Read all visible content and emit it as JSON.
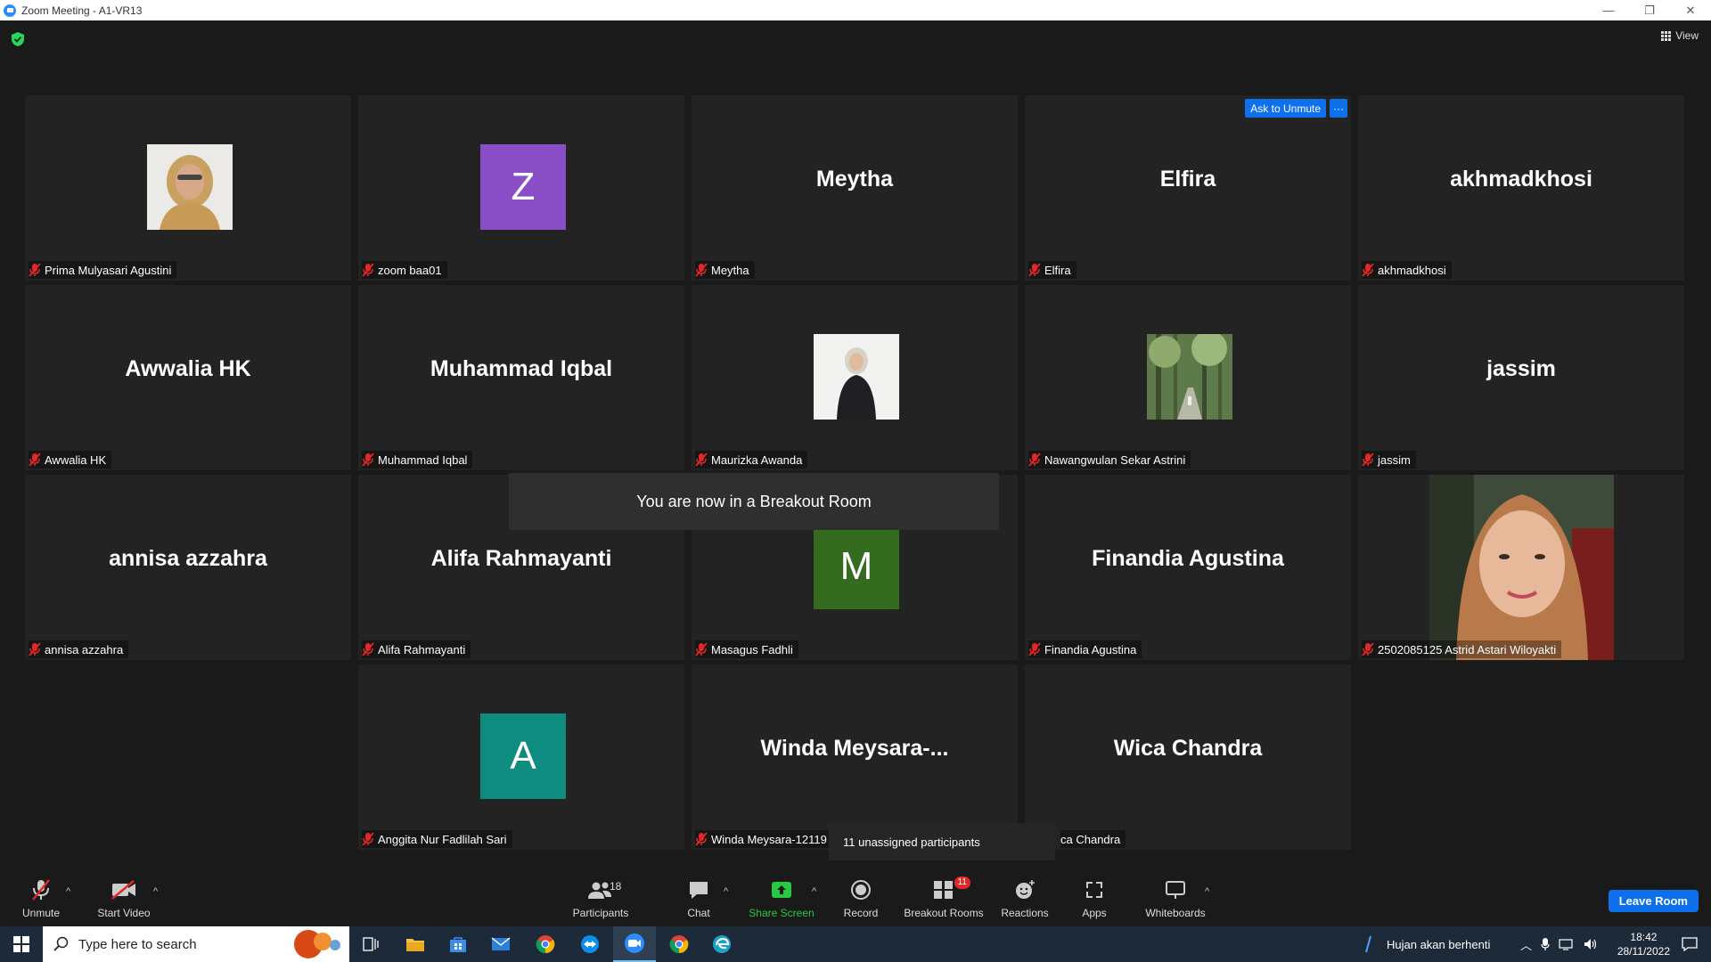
{
  "window": {
    "title": "Zoom Meeting - A1-VR13",
    "minimize": "—",
    "restore": "❐",
    "close": "✕"
  },
  "top": {
    "view_label": "View"
  },
  "tiles": [
    {
      "display": "",
      "label": "Prima Mulyasari Agustini",
      "kind": "photo"
    },
    {
      "display": "Z",
      "label": "zoom baa01",
      "kind": "letter",
      "color": "#8a4fc7"
    },
    {
      "display": "Meytha",
      "label": "Meytha",
      "kind": "name"
    },
    {
      "display": "Elfira",
      "label": "Elfira",
      "kind": "name",
      "ask_unmute": "Ask to Unmute",
      "more": "···"
    },
    {
      "display": "akhmadkhosi",
      "label": "akhmadkhosi",
      "kind": "name"
    },
    {
      "display": "Awwalia HK",
      "label": "Awwalia HK",
      "kind": "name"
    },
    {
      "display": "Muhammad Iqbal",
      "label": "Muhammad Iqbal",
      "kind": "name"
    },
    {
      "display": "",
      "label": "Maurizka Awanda",
      "kind": "photo"
    },
    {
      "display": "",
      "label": "Nawangwulan Sekar Astrini",
      "kind": "photo"
    },
    {
      "display": "jassim",
      "label": "jassim",
      "kind": "name"
    },
    {
      "display": "annisa azzahra",
      "label": "annisa azzahra",
      "kind": "name"
    },
    {
      "display": "Alifa Rahmayanti",
      "label": "Alifa Rahmayanti",
      "kind": "name"
    },
    {
      "display": "M",
      "label": "Masagus Fadhli",
      "kind": "letter",
      "color": "#356b1e"
    },
    {
      "display": "Finandia Agustina",
      "label": "Finandia Agustina",
      "kind": "name"
    },
    {
      "display": "",
      "label": "2502085125 Astrid Astari Wiloyakti",
      "kind": "video"
    },
    {
      "display": "A",
      "label": "Anggita Nur Fadlilah Sari",
      "kind": "letter",
      "color": "#0e8c7f"
    },
    {
      "display": "Winda  Meysara-...",
      "label": "Winda Meysara-12119",
      "kind": "name"
    },
    {
      "display": "Wica Chandra",
      "label": "ca Chandra",
      "kind": "name"
    }
  ],
  "toast": "You are now in a Breakout Room",
  "tooltip": "11 unassigned participants",
  "toolbar": {
    "unmute": "Unmute",
    "start_video": "Start Video",
    "participants": "Participants",
    "participants_count": "18",
    "chat": "Chat",
    "share_screen": "Share Screen",
    "record": "Record",
    "breakout_rooms": "Breakout Rooms",
    "breakout_badge": "11",
    "reactions": "Reactions",
    "apps": "Apps",
    "whiteboards": "Whiteboards",
    "leave": "Leave Room",
    "caret": "^"
  },
  "taskbar": {
    "search_placeholder": "Type here to search",
    "weather": "Hujan akan berhenti",
    "time": "18:42",
    "date": "28/11/2022"
  },
  "colors": {
    "accent": "#0e71eb",
    "muted": "#e02828",
    "share": "#28c840"
  }
}
